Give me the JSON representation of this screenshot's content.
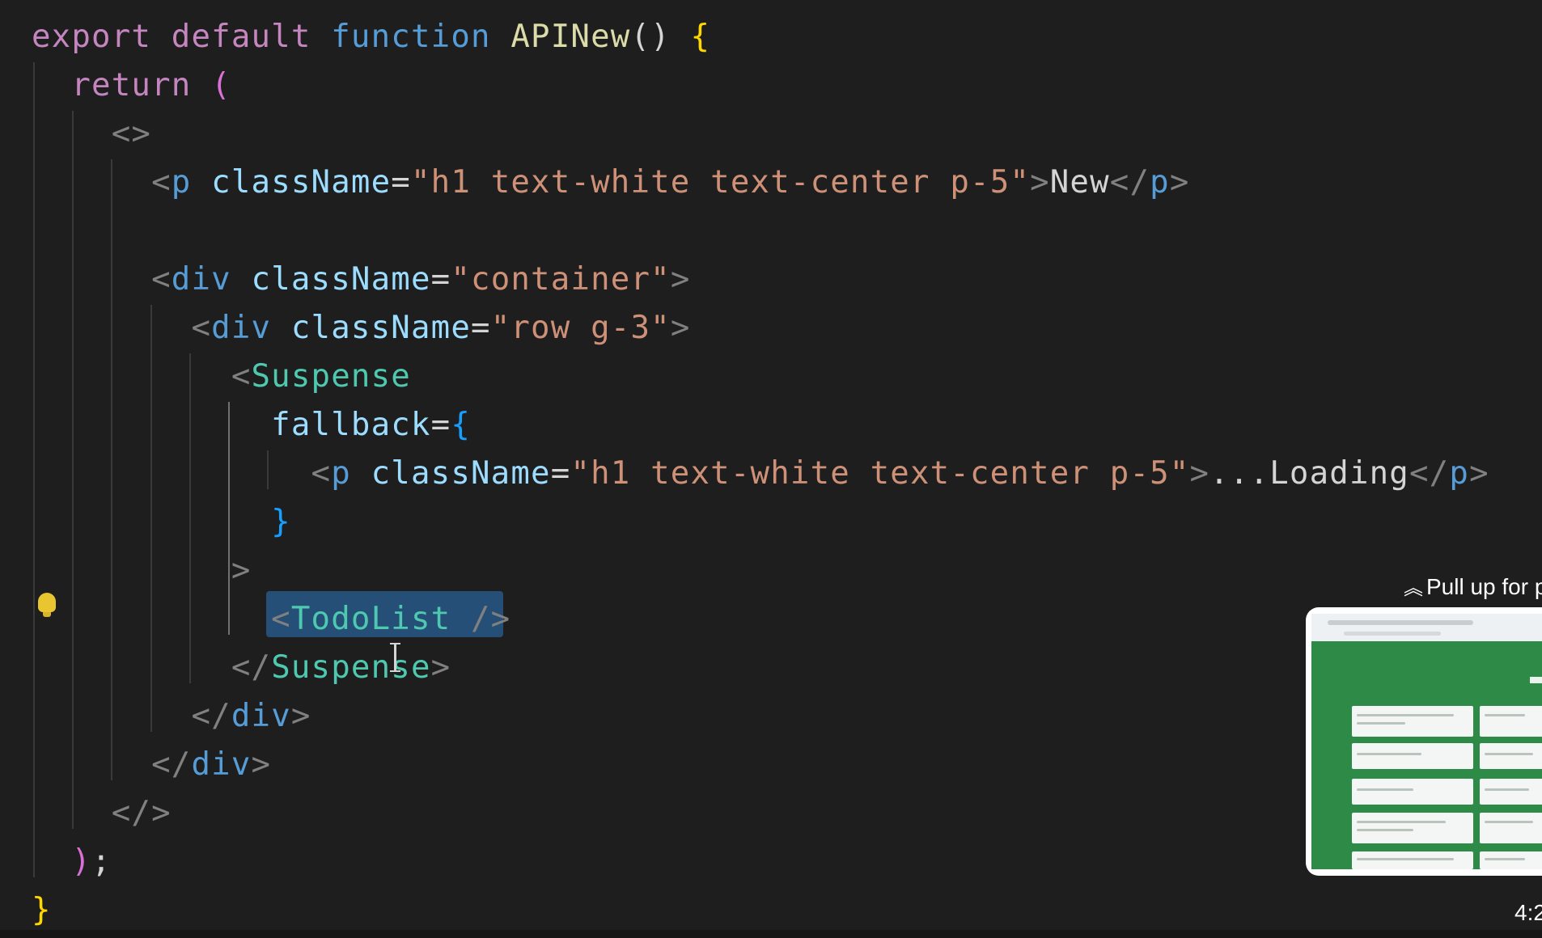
{
  "editor": {
    "lines": [
      [
        {
          "t": "export",
          "c": "t-keyword"
        },
        {
          "t": " "
        },
        {
          "t": "default",
          "c": "t-keyword"
        },
        {
          "t": " "
        },
        {
          "t": "function",
          "c": "t-function"
        },
        {
          "t": " "
        },
        {
          "t": "APINew",
          "c": "t-name"
        },
        {
          "t": "()",
          "c": "t-punct"
        },
        {
          "t": " "
        },
        {
          "t": "{",
          "c": "t-brace1"
        }
      ],
      [
        {
          "t": "  "
        },
        {
          "t": "return",
          "c": "t-keyword"
        },
        {
          "t": " "
        },
        {
          "t": "(",
          "c": "t-brace2"
        }
      ],
      [
        {
          "t": "    "
        },
        {
          "t": "<>",
          "c": "t-tagbracket"
        }
      ],
      [
        {
          "t": "      "
        },
        {
          "t": "<",
          "c": "t-tagbracket"
        },
        {
          "t": "p",
          "c": "t-tag"
        },
        {
          "t": " "
        },
        {
          "t": "className",
          "c": "t-attr"
        },
        {
          "t": "=",
          "c": "t-punct"
        },
        {
          "t": "\"h1 text-white text-center p-5\"",
          "c": "t-string"
        },
        {
          "t": ">",
          "c": "t-tagbracket"
        },
        {
          "t": "New",
          "c": "t-text"
        },
        {
          "t": "</",
          "c": "t-tagbracket"
        },
        {
          "t": "p",
          "c": "t-tag"
        },
        {
          "t": ">",
          "c": "t-tagbracket"
        }
      ],
      [],
      [
        {
          "t": "      "
        },
        {
          "t": "<",
          "c": "t-tagbracket"
        },
        {
          "t": "div",
          "c": "t-tag"
        },
        {
          "t": " "
        },
        {
          "t": "className",
          "c": "t-attr"
        },
        {
          "t": "=",
          "c": "t-punct"
        },
        {
          "t": "\"container\"",
          "c": "t-string"
        },
        {
          "t": ">",
          "c": "t-tagbracket"
        }
      ],
      [
        {
          "t": "        "
        },
        {
          "t": "<",
          "c": "t-tagbracket"
        },
        {
          "t": "div",
          "c": "t-tag"
        },
        {
          "t": " "
        },
        {
          "t": "className",
          "c": "t-attr"
        },
        {
          "t": "=",
          "c": "t-punct"
        },
        {
          "t": "\"row g-3\"",
          "c": "t-string"
        },
        {
          "t": ">",
          "c": "t-tagbracket"
        }
      ],
      [
        {
          "t": "          "
        },
        {
          "t": "<",
          "c": "t-tagbracket"
        },
        {
          "t": "Suspense",
          "c": "t-component"
        }
      ],
      [
        {
          "t": "            "
        },
        {
          "t": "fallback",
          "c": "t-attr"
        },
        {
          "t": "=",
          "c": "t-punct"
        },
        {
          "t": "{",
          "c": "t-brace3"
        }
      ],
      [
        {
          "t": "              "
        },
        {
          "t": "<",
          "c": "t-tagbracket"
        },
        {
          "t": "p",
          "c": "t-tag"
        },
        {
          "t": " "
        },
        {
          "t": "className",
          "c": "t-attr"
        },
        {
          "t": "=",
          "c": "t-punct"
        },
        {
          "t": "\"h1 text-white text-center p-5\"",
          "c": "t-string"
        },
        {
          "t": ">",
          "c": "t-tagbracket"
        },
        {
          "t": "...Loading",
          "c": "t-text"
        },
        {
          "t": "</",
          "c": "t-tagbracket"
        },
        {
          "t": "p",
          "c": "t-tag"
        },
        {
          "t": ">",
          "c": "t-tagbracket"
        }
      ],
      [
        {
          "t": "            "
        },
        {
          "t": "}",
          "c": "t-brace3"
        }
      ],
      [
        {
          "t": "          "
        },
        {
          "t": ">",
          "c": "t-tagbracket"
        }
      ],
      [
        {
          "t": "            "
        },
        {
          "t": "<",
          "c": "t-tagbracket"
        },
        {
          "t": "TodoList",
          "c": "t-component"
        },
        {
          "t": " "
        },
        {
          "t": "/>",
          "c": "t-tagbracket"
        }
      ],
      [
        {
          "t": "          "
        },
        {
          "t": "</",
          "c": "t-tagbracket"
        },
        {
          "t": "Suspense",
          "c": "t-component"
        },
        {
          "t": ">",
          "c": "t-tagbracket"
        }
      ],
      [
        {
          "t": "        "
        },
        {
          "t": "</",
          "c": "t-tagbracket"
        },
        {
          "t": "div",
          "c": "t-tag"
        },
        {
          "t": ">",
          "c": "t-tagbracket"
        }
      ],
      [
        {
          "t": "      "
        },
        {
          "t": "</",
          "c": "t-tagbracket"
        },
        {
          "t": "div",
          "c": "t-tag"
        },
        {
          "t": ">",
          "c": "t-tagbracket"
        }
      ],
      [
        {
          "t": "    "
        },
        {
          "t": "</>",
          "c": "t-tagbracket"
        }
      ],
      [
        {
          "t": "  "
        },
        {
          "t": ")",
          "c": "t-brace2"
        },
        {
          "t": ";",
          "c": "t-punct"
        }
      ],
      [
        {
          "t": "}",
          "c": "t-brace1"
        }
      ]
    ],
    "selected_text": "<TodoList />"
  },
  "miniplayer": {
    "pull_up_label": "Pull up for p",
    "chevron_icon": "double-chevron-up-icon",
    "timestamp": "4:2"
  },
  "colors": {
    "background": "#1e1e1e",
    "selection": "#264f78",
    "thumbnail_green": "#2d8a47"
  }
}
